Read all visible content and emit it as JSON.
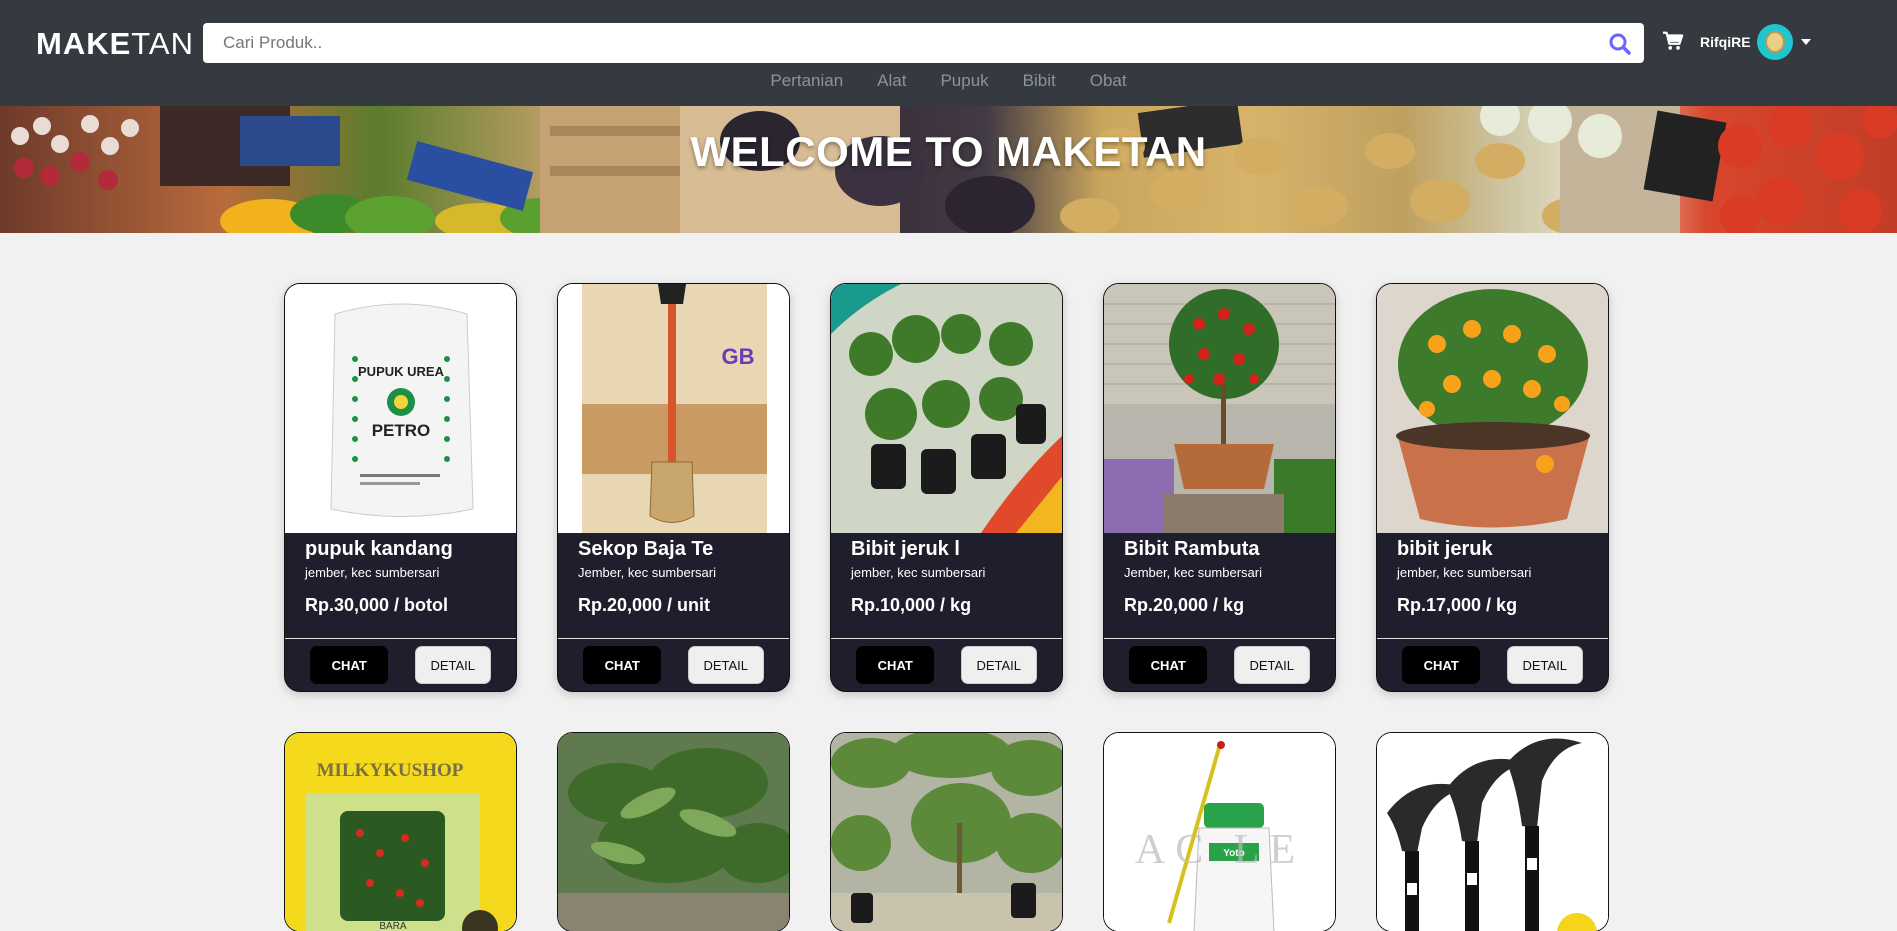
{
  "brand": {
    "bold": "MAKE",
    "light": "TAN"
  },
  "search": {
    "placeholder": "Cari Produk.."
  },
  "user": {
    "name": "RifqiRE"
  },
  "categories": [
    "Pertanian",
    "Alat",
    "Pupuk",
    "Bibit",
    "Obat"
  ],
  "hero": {
    "title": "WELCOME TO MAKETAN"
  },
  "buttons": {
    "chat": "CHAT",
    "detail": "DETAIL"
  },
  "products": [
    {
      "name": "pupuk kandang",
      "location": "jember, kec sumbersari",
      "price": "Rp.30,000 / botol",
      "image_label": "PUPUK UREA",
      "image_brand": "PETRO"
    },
    {
      "name": "Sekop Baja Te",
      "location": "Jember, kec sumbersari",
      "price": "Rp.20,000 / unit",
      "image_logo": "GB"
    },
    {
      "name": "Bibit jeruk l",
      "location": "jember, kec sumbersari",
      "price": "Rp.10,000 / kg"
    },
    {
      "name": "Bibit Rambuta",
      "location": "Jember, kec sumbersari",
      "price": "Rp.20,000 / kg"
    },
    {
      "name": "bibit jeruk",
      "location": "jember, kec sumbersari",
      "price": "Rp.17,000 / kg"
    }
  ],
  "products_row2": [
    {
      "image_label": "MILKYKUSHOP",
      "image_sub": "BARA"
    },
    {},
    {},
    {
      "image_label": "AC LE",
      "image_sub": "Yoto"
    },
    {}
  ],
  "colors": {
    "navbar": "#343a40",
    "card_body": "#1f1e2c",
    "accent": "#6c63ff"
  }
}
